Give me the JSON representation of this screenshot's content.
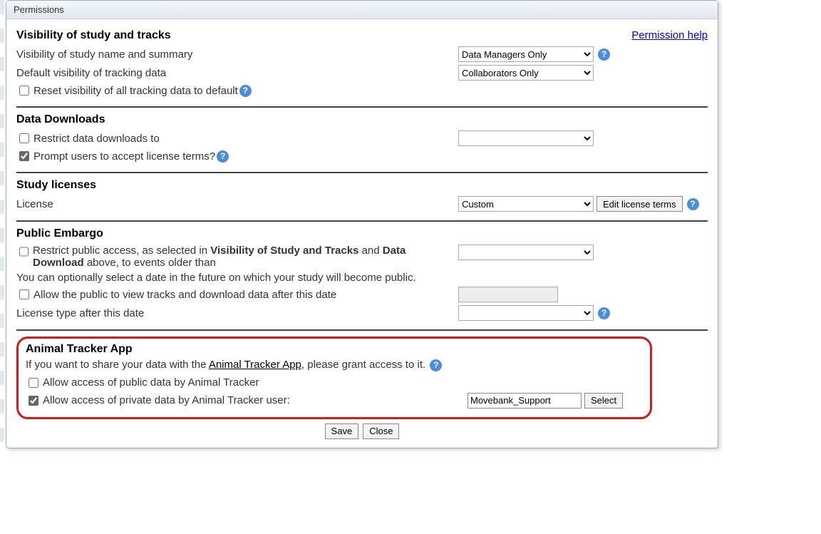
{
  "title": "Permissions",
  "help_link": "Permission help",
  "sections": {
    "visibility": {
      "heading": "Visibility of study and tracks",
      "row_name_summary": "Visibility of study name and summary",
      "dd_name_summary": "Data Managers Only",
      "row_tracking": "Default visibility of tracking data",
      "dd_tracking": "Collaborators Only",
      "reset_label": "Reset visibility of all tracking data to default"
    },
    "downloads": {
      "heading": "Data Downloads",
      "restrict_label": "Restrict data downloads to",
      "prompt_label": "Prompt users to accept license terms?"
    },
    "licenses": {
      "heading": "Study licenses",
      "license_label": "License",
      "dd_license": "Custom",
      "edit_btn": "Edit license terms"
    },
    "embargo": {
      "heading": "Public Embargo",
      "restrict_prefix": "Restrict public access, as selected in ",
      "restrict_bold1": "Visibility of Study and Tracks",
      "restrict_mid": " and ",
      "restrict_bold2": "Data Download",
      "restrict_suffix": " above, to events older than",
      "note": "You can optionally select a date in the future on which your study will become public.",
      "allow_public_label": "Allow the public to view tracks and download data after this date",
      "license_after_label": "License type after this date"
    },
    "animal": {
      "heading": "Animal Tracker App",
      "intro_prefix": "If you want to share your data with the ",
      "intro_link": "Animal Tracker App",
      "intro_suffix": ", please grant access to it.",
      "public_label": "Allow access of public data by Animal Tracker",
      "private_label": "Allow access of private data by Animal Tracker user:",
      "user_value": "Movebank_Support",
      "select_btn": "Select"
    }
  },
  "buttons": {
    "save": "Save",
    "close": "Close"
  },
  "help_q": "?"
}
